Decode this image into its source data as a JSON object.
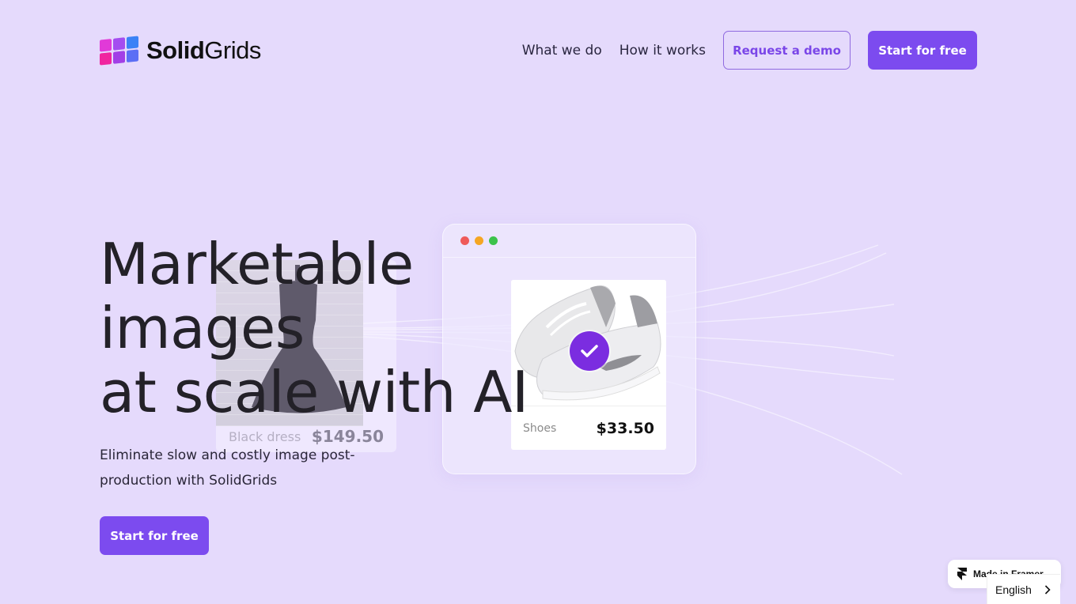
{
  "header": {
    "logo": {
      "bold": "Solid",
      "light": "Grids",
      "colors": [
        "#e13ad8",
        "#a44df0",
        "#3b82f6",
        "#f0259f",
        "#a23fe6",
        "#5b6ef5"
      ]
    },
    "nav": [
      {
        "label": "What we do"
      },
      {
        "label": "How it works"
      }
    ],
    "request_demo_label": "Request a demo",
    "start_free_label": "Start for free"
  },
  "hero": {
    "title_lines": [
      "Marketable",
      "images",
      "at scale with AI"
    ],
    "subtitle": "Eliminate slow and costly image post-production with SolidGrids",
    "cta_label": "Start for free"
  },
  "illustration": {
    "dress_card": {
      "name": "Black dress",
      "price": "$149.50"
    },
    "browser": {
      "dots": [
        "#ef5a5a",
        "#f5a623",
        "#3cc24b"
      ],
      "product": {
        "name": "Shoes",
        "price": "$33.50",
        "badge_icon": "check-icon"
      }
    }
  },
  "framer": {
    "label": "Made in Framer"
  },
  "language": {
    "selected": "English"
  },
  "colors": {
    "background": "#e5dafc",
    "accent": "#7c4bef",
    "badge": "#7b2de0"
  }
}
